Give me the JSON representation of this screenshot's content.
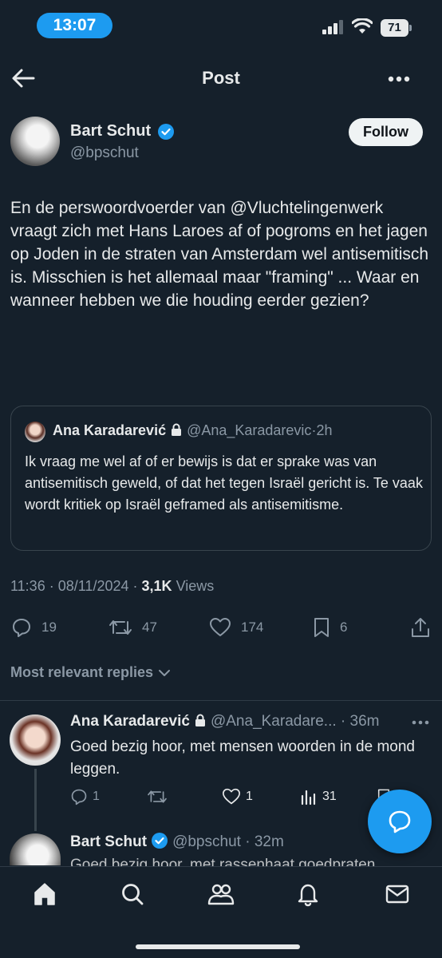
{
  "status_bar": {
    "time": "13:07",
    "battery": "71"
  },
  "header": {
    "title": "Post",
    "back_icon": "arrow-left-icon",
    "more_icon": "more-horizontal-icon"
  },
  "post": {
    "author_name": "Bart Schut",
    "author_handle": "@bpschut",
    "follow_label": "Follow",
    "text": "En de perswoordvoerder van @Vluchtelingenwerk vraagt zich met Hans Laroes af of pogroms en het jagen op Joden in de straten van Amsterdam wel antisemitisch is. Misschien is het allemaal maar \"framing\" ... Waar en wanneer hebben we die houding eerder gezien?",
    "quote": {
      "author_name": "Ana Karadarević",
      "author_handle": "@Ana_Karadarevic",
      "time": "2h",
      "text": "Ik vraag me wel af of er bewijs is dat er sprake was van antisemitisch geweld, of dat het tegen Israël gericht is. Te vaak wordt kritiek op Israël geframed als antisemitisme."
    },
    "time": "11:36",
    "date": "08/11/2024",
    "views_count": "3,1K",
    "views_label": "Views",
    "actions": {
      "replies": "19",
      "reposts": "47",
      "likes": "174",
      "bookmarks": "6"
    }
  },
  "replies_section": {
    "label": "Most relevant replies"
  },
  "replies": [
    {
      "author_name": "Ana Karadarević",
      "author_handle": "@Ana_Karadare...",
      "time": "36m",
      "text": "Goed bezig hoor, met mensen woorden in de mond leggen.",
      "replies": "1",
      "likes": "1",
      "views": "31"
    },
    {
      "author_name": "Bart Schut",
      "author_handle": "@bpschut",
      "time": "32m",
      "text": "Goed bezig hoor, met rassenhaat goedpraten"
    }
  ],
  "colors": {
    "background": "#15202b",
    "accent": "#1d9bf0",
    "text": "#e7e9ea",
    "muted": "#8b98a5"
  }
}
